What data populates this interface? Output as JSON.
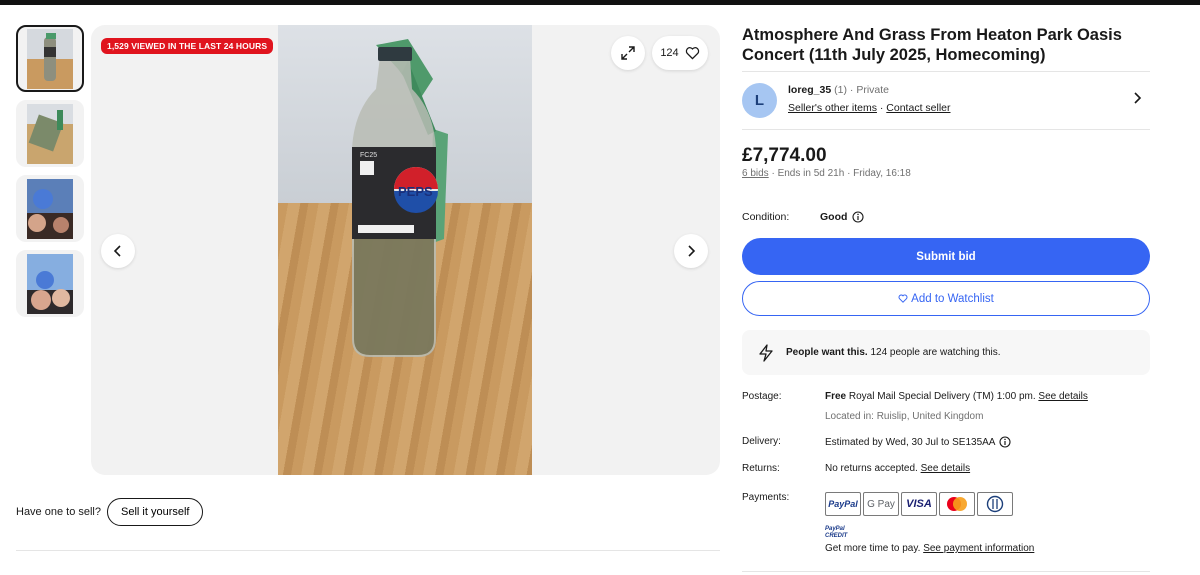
{
  "gallery": {
    "views_badge": "1,529 VIEWED IN THE LAST 24 HOURS",
    "watch_count": "124",
    "thumbnail_count": 4
  },
  "sell": {
    "prompt": "Have one to sell?",
    "button": "Sell it yourself"
  },
  "listing": {
    "title": "Atmosphere And Grass From Heaton Park Oasis Concert (11th July 2025, Homecoming)",
    "seller": {
      "avatar_letter": "L",
      "name": "loreg_35",
      "feedback": "(1)",
      "separator": " · ",
      "type": "Private",
      "other_items": "Seller's other items",
      "contact": "Contact seller"
    },
    "price": "£7,774.00",
    "bids_link": "6 bids",
    "bids_rest": " · Ends in 5d 21h · Friday, 16:18",
    "condition_label": "Condition:",
    "condition_value": "Good",
    "submit_bid": "Submit bid",
    "add_watchlist": "Add to Watchlist",
    "people_bold": "People want this.",
    "people_text": " 124 people are watching this.",
    "postage": {
      "label": "Postage:",
      "free": "Free",
      "text": " Royal Mail Special Delivery (TM) 1:00 pm. ",
      "link": "See details",
      "located": "Located in: Ruislip, United Kingdom"
    },
    "delivery": {
      "label": "Delivery:",
      "text": "Estimated by Wed, 30 Jul to SE135AA"
    },
    "returns": {
      "label": "Returns:",
      "text": "No returns accepted. ",
      "link": "See details"
    },
    "payments": {
      "label": "Payments:",
      "methods": [
        "PayPal",
        "G Pay",
        "VISA",
        "Mastercard",
        "Diners Club"
      ],
      "credit_badge": "PayPal CREDIT",
      "credit_text": "Get more time to pay. ",
      "credit_link": "See payment information"
    }
  },
  "colors": {
    "accent": "#3665f3",
    "badge": "#e0141e",
    "text": "#191919",
    "muted": "#707070"
  }
}
